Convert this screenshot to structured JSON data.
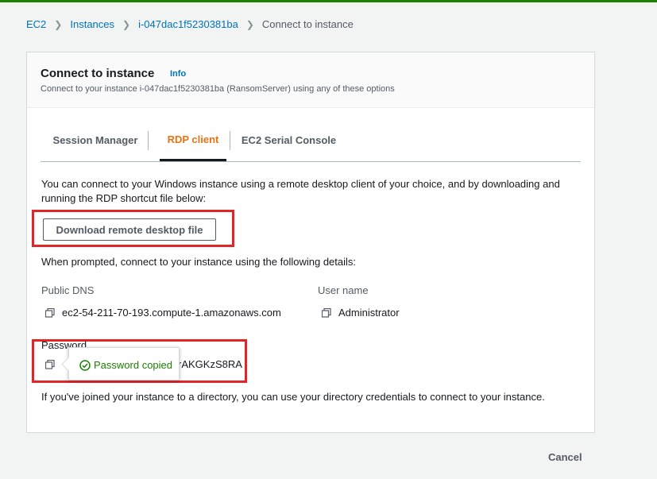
{
  "colors": {
    "accent": "#ec7211",
    "link": "#0073bb",
    "success": "#1d8102",
    "highlight": "#e0262b"
  },
  "breadcrumb": {
    "items": [
      "EC2",
      "Instances",
      "i-047dac1f5230381ba"
    ],
    "current": "Connect to instance"
  },
  "header": {
    "title": "Connect to instance",
    "info": "Info",
    "description": "Connect to your instance i-047dac1f5230381ba (RansomServer) using any of these options"
  },
  "tabs": [
    {
      "label": "Session Manager",
      "active": false
    },
    {
      "label": "RDP client",
      "active": true
    },
    {
      "label": "EC2 Serial Console",
      "active": false
    }
  ],
  "rdp": {
    "intro_line1": "You can connect to your Windows instance using a remote desktop client of your choice, and by downloading and",
    "intro_line2": "running the RDP shortcut file below:",
    "download_button": "Download remote desktop file",
    "prompt": "When prompted, connect to your instance using the following details:",
    "public_dns_label": "Public DNS",
    "public_dns_value": "ec2-54-211-70-193.compute-1.amazonaws.com",
    "username_label": "User name",
    "username_value": "Administrator",
    "password_label": "Password",
    "password_partial": "rAKGKzS8RA",
    "tooltip": "Password copied",
    "directory_note": "If you've joined your instance to a directory, you can use your directory credentials to connect to your instance."
  },
  "footer": {
    "cancel": "Cancel"
  }
}
